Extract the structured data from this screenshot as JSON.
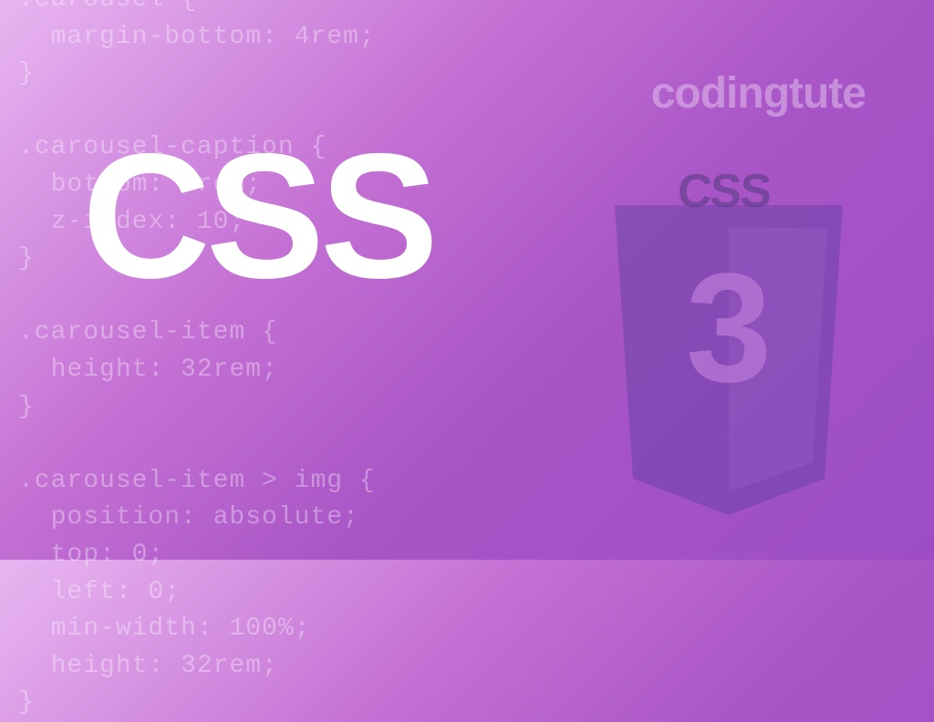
{
  "main_title": "CSS",
  "brand_text": "codingtute",
  "css_label": "CSS",
  "logo_number": "3",
  "code_snippet": ".carousel {\n  margin-bottom: 4rem;\n}\n\n.carousel-caption {\n  bottom: 3rem;\n  z-index: 10;\n}\n\n.carousel-item {\n  height: 32rem;\n}\n\n.carousel-item > img {\n  position: absolute;\n  top: 0;\n  left: 0;\n  min-width: 100%;\n  height: 32rem;\n}"
}
